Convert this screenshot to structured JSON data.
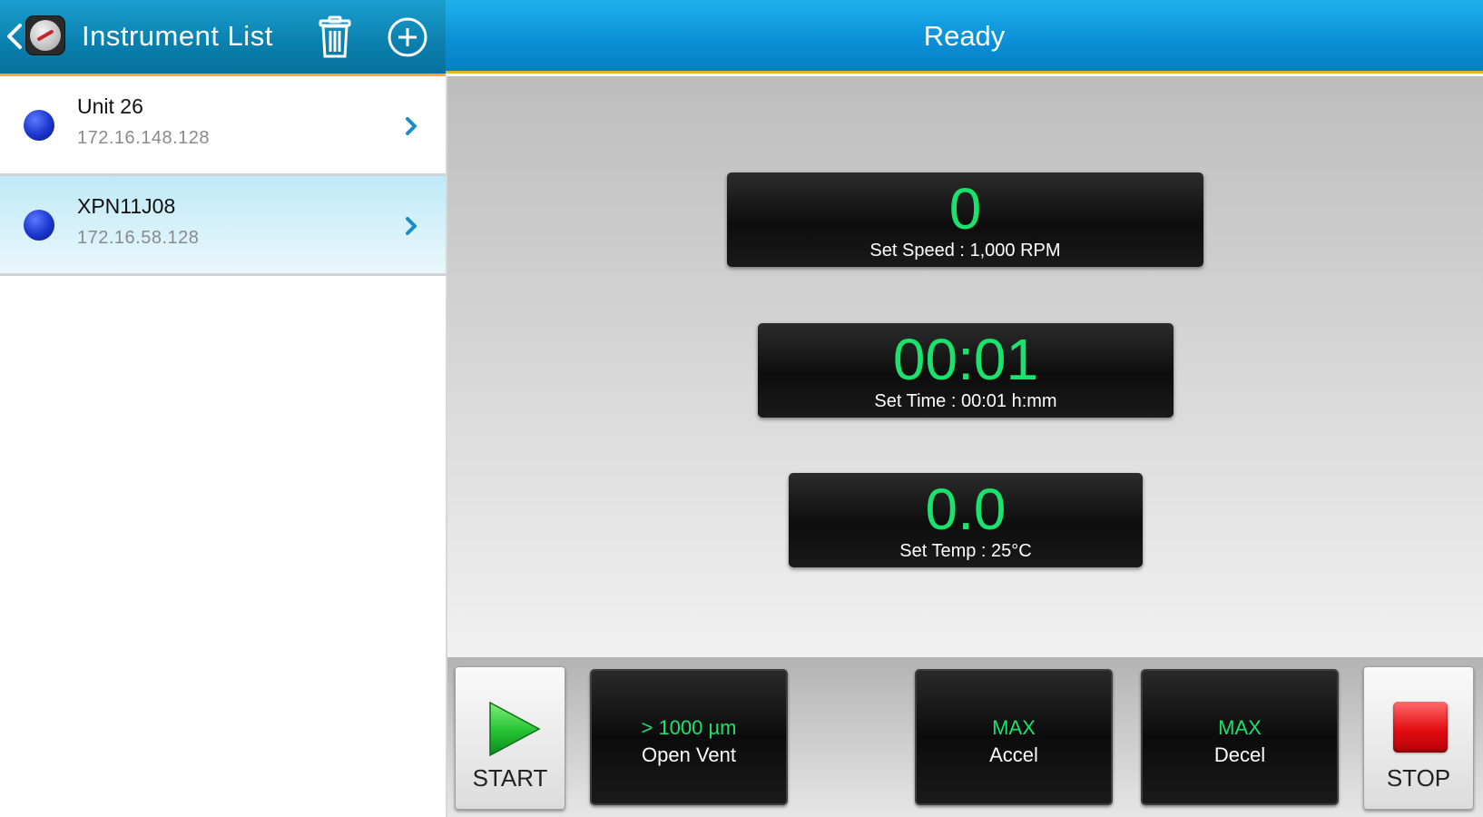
{
  "left_panel": {
    "title": "Instrument List",
    "instruments": [
      {
        "name": "Unit 26",
        "ip": "172.16.148.128",
        "selected": false
      },
      {
        "name": "XPN11J08",
        "ip": "172.16.58.128",
        "selected": true
      }
    ]
  },
  "status": {
    "title": "Ready"
  },
  "readouts": {
    "speed": {
      "value": "0",
      "setting": "Set Speed : 1,000 RPM"
    },
    "time": {
      "value": "00:01",
      "setting": "Set Time : 00:01 h:mm"
    },
    "temp": {
      "value": "0.0",
      "setting": "Set Temp : 25°C"
    }
  },
  "controls": {
    "start_label": "START",
    "stop_label": "STOP",
    "vent": {
      "value": "> 1000 µm",
      "label": "Open Vent"
    },
    "accel": {
      "value": "MAX",
      "label": "Accel"
    },
    "decel": {
      "value": "MAX",
      "label": "Decel"
    }
  },
  "colors": {
    "accent_green": "#19e26d",
    "header_blue": "#0a8fd6",
    "header_teal": "#0a7fae",
    "divider_gold": "#e6b32a",
    "stop_red": "#e40e13",
    "status_dot_blue": "#1a35cc"
  },
  "icons": {
    "back": "chevron-left-icon",
    "logo": "app-logo-icon",
    "delete": "trash-icon",
    "add": "plus-circle-icon",
    "row_arrow": "chevron-right-icon",
    "start": "play-icon",
    "stop": "stop-square-icon"
  }
}
